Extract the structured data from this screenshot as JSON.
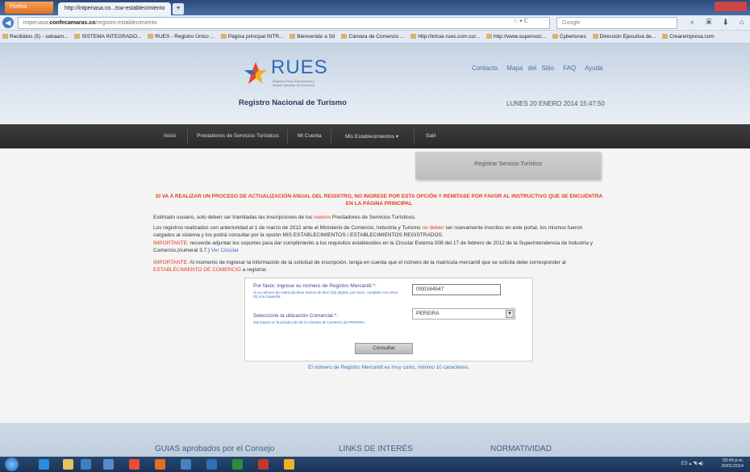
{
  "browser": {
    "menu_button": "Firefox",
    "tab_title": "http://intpenasa.co...tsw-establecimiento",
    "new_tab": "+",
    "url_domain": "confecamaras.co",
    "url_prefix": "intpenasa.",
    "url_suffix": "/registro-establecimiento",
    "url_tools": "☆ ▾ C",
    "search_engine": "Google",
    "nav_tools": "⌕ ▣ ⬇ ⌂",
    "bookmarks": [
      "Recibidos (5) - sebaam...",
      "SISTEMA INTEGRADO...",
      "RUES - Registro Único ...",
      "Página principal INTR...",
      "Bienvenido a SII",
      "Cámara de Comercio ...",
      "http://intrue.rues.com.co/...",
      "http://www.supersoci...",
      "Cyberlunes",
      "Dirección Ejecutiva de...",
      "Crearempresa.com"
    ]
  },
  "site": {
    "logo_text": "RUES",
    "logo_subtitle": "Registro Único Empresarial y Social Cámaras de Comercio",
    "title": "Registro Nacional de Turismo",
    "top_links": [
      "Contacto",
      "Mapa del Sitio",
      "FAQ",
      "Ayuda"
    ],
    "date": "LUNES 20 ENERO 2014 15:47:50",
    "menu": [
      "Inicio",
      "Prestadores de Servicios Turísticos",
      "Mi Cuenta",
      "Mis Establecimientos ▾",
      "Salir"
    ],
    "register_tab": "Registrar Servicio Turístico",
    "alert": "SI VA A REALIZAR UN PROCESO DE ACTUALIZACIÓN ANUAL DEL REGISTRO, NO INGRESE POR ESTA OPCIÓN Y REMITASE POR FAVOR AL INSTRUCTIVO QUE SE ENCUENTRA EN LA PÁGINA PRINCIPAL",
    "p1_before": "Estimado usuario, solo deben ser tramitadas las inscripciones de los ",
    "p1_highlight": "nuevos",
    "p1_after": " Prestadores de Servicios Turísticos.",
    "p2_before": "Los registros realizados con anterioridad al 1 de marzo de 2012 ante el Ministerio de Comercio, Industria y Turismo ",
    "p2_highlight": "no deben",
    "p2_after": " ser nuevamente inscritos en este portal, los mismos fueron cargados al sistema y los podrá consultar por la opción MIS ESTABLECIMIENTOS / ESTABLECIMIENTOS REGISTRADOS.",
    "p3_label": "IMPORTANTE:",
    "p3_text": " recuerde adjuntar los soportes para dar cumplimiento a los requisitos establecidos en la Circular Externa 008 del 17 de febrero de 2012 de la Superintendencia de Industria y Comercio.(numeral 3.7.) ",
    "p3_link": "Ver Circular",
    "p4_label": "IMPORTANTE:",
    "p4_text": " Al momento de ingresar la información de la solicitud de inscripción, tenga en cuenta que el número de la matrícula mercantil que se solicita debe corresponder al ",
    "p4_highlight": "ESTABLECIMIENTO DE COMERCIO",
    "p4_after": " a registrar.",
    "form": {
      "reg_label": "Por favor, ingrese su número de Registro Mercantil *:",
      "reg_help": "Si su número de matrícula tiene menos de diez (10) dígitos, por favor, complete con ceros (0) a la izquierda",
      "reg_value": "00|0164547",
      "city_label": "Seleccione la ubicación Comercial *:",
      "city_help": "Municipios en la jurisdicción de la Cámara de Comercio de PEREIRA.",
      "city_value": "PEREIRA",
      "button": "Consultar",
      "error": "El número de Registro Mercantil es muy corto, mínimo 10 caracteres."
    },
    "footer": [
      "GUIAS aprobados por el Consejo",
      "LINKS DE INTERÉS",
      "NORMATIVIDAD"
    ]
  },
  "taskbar": {
    "tray_icons": "ES ▴ ◥ ◀)",
    "time": "03:49 p.m.",
    "date": "20/01/2014"
  }
}
